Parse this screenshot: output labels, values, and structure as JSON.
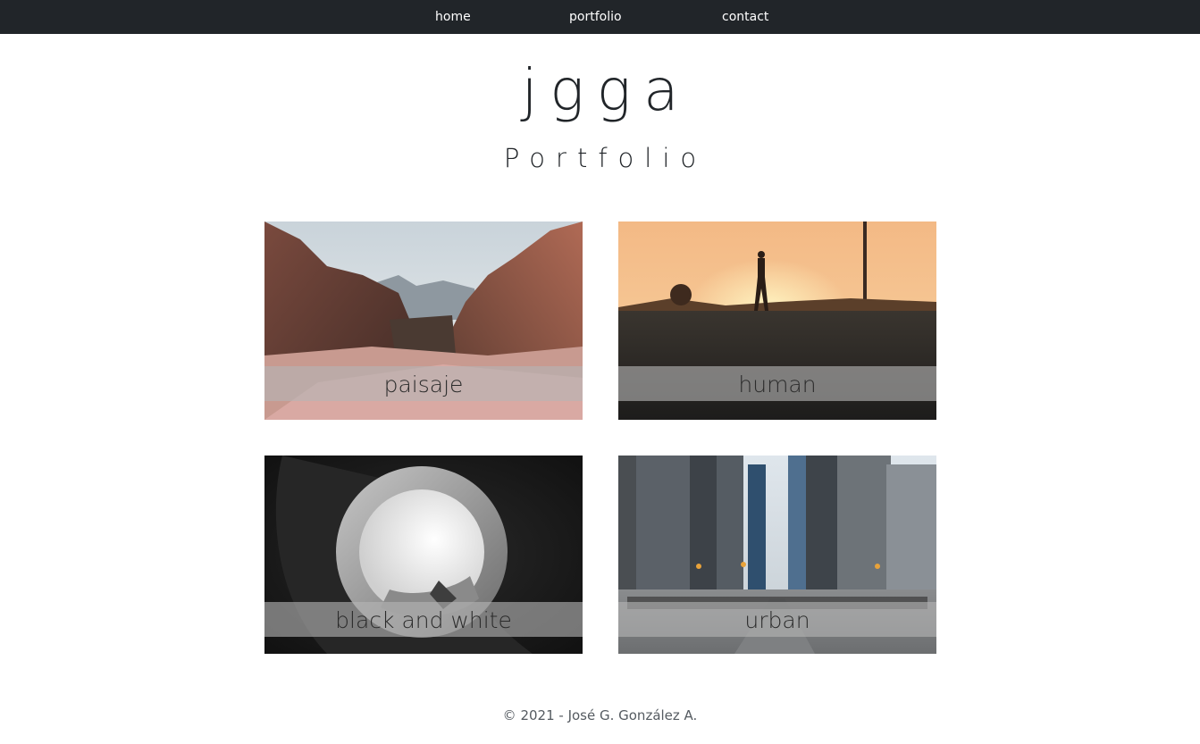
{
  "nav": {
    "items": [
      {
        "label": "home"
      },
      {
        "label": "portfolio"
      },
      {
        "label": "contact"
      }
    ]
  },
  "header": {
    "title": "jgga",
    "subtitle": "Portfolio"
  },
  "gallery": {
    "cards": [
      {
        "caption": "paisaje",
        "image": "canyon-landscape-photo"
      },
      {
        "caption": "human",
        "image": "person-walking-sunset-photo"
      },
      {
        "caption": "black and white",
        "image": "spiral-architecture-photo"
      },
      {
        "caption": "urban",
        "image": "city-street-skyscrapers-photo"
      }
    ]
  },
  "footer": {
    "text": "© 2021 - José G. González A."
  },
  "colors": {
    "navbar": "#212529",
    "caption_overlay": "rgba(180,180,180,0.62)"
  }
}
